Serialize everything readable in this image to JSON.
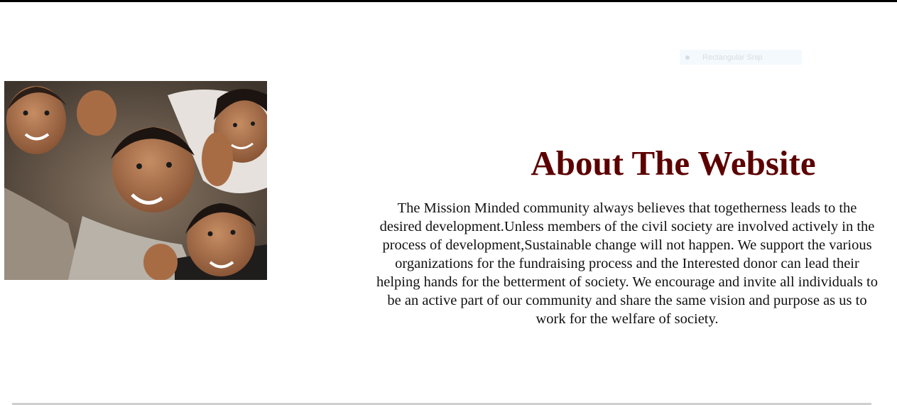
{
  "tooltip": {
    "label": "Rectangular Snip",
    "icon": "scissors-icon"
  },
  "image": {
    "alt": "Group of smiling children",
    "icon": "photo"
  },
  "about": {
    "heading": "About The Website",
    "paragraph": "The Mission Minded community always believes that togetherness leads to the desired development.Unless members of the civil society are involved actively in the process of development,Sustainable change will not happen. We support the various organizations for the fundraising process and the Interested donor can lead their helping hands for the betterment of society. We encourage and invite all individuals to be an active part of our community and share the same vision and purpose as us to work for the welfare of society."
  },
  "colors": {
    "heading": "#5c0000",
    "text": "#111111",
    "background": "#ffffff"
  }
}
